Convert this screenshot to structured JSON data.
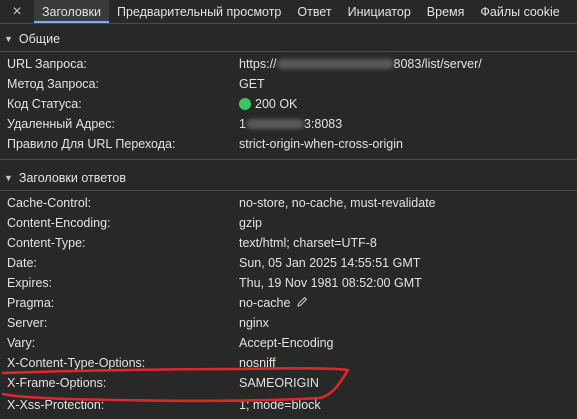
{
  "tabs": [
    {
      "label": "Заголовки",
      "active": true
    },
    {
      "label": "Предварительный просмотр",
      "active": false
    },
    {
      "label": "Ответ",
      "active": false
    },
    {
      "label": "Инициатор",
      "active": false
    },
    {
      "label": "Время",
      "active": false
    },
    {
      "label": "Файлы cookie",
      "active": false
    }
  ],
  "close_icon": "×",
  "general": {
    "title": "Общие",
    "rows": [
      {
        "key": "URL Запроса:",
        "value_prefix": "https://",
        "value_suffix": "8083/list/server/"
      },
      {
        "key": "Метод Запроса:",
        "value": "GET"
      },
      {
        "key": "Код Статуса:",
        "value": "200 OK",
        "status_color": "#3ec463"
      },
      {
        "key": "Удаленный Адрес:",
        "value_prefix": "1",
        "value_suffix": "3:8083"
      },
      {
        "key": "Правило Для URL Перехода:",
        "value": "strict-origin-when-cross-origin"
      }
    ]
  },
  "response_headers": {
    "title": "Заголовки ответов",
    "rows": [
      {
        "key": "Cache-Control:",
        "value": "no-store, no-cache, must-revalidate"
      },
      {
        "key": "Content-Encoding:",
        "value": "gzip"
      },
      {
        "key": "Content-Type:",
        "value": "text/html; charset=UTF-8"
      },
      {
        "key": "Date:",
        "value": "Sun, 05 Jan 2025 14:55:51 GMT"
      },
      {
        "key": "Expires:",
        "value": "Thu, 19 Nov 1981 08:52:00 GMT"
      },
      {
        "key": "Pragma:",
        "value": "no-cache"
      },
      {
        "key": "Server:",
        "value": "nginx"
      },
      {
        "key": "Vary:",
        "value": "Accept-Encoding"
      },
      {
        "key": "X-Content-Type-Options:",
        "value": "nosniff"
      },
      {
        "key": "X-Frame-Options:",
        "value": "SAMEORIGIN"
      },
      {
        "key": "X-Xss-Protection:",
        "value": "1; mode=block"
      }
    ]
  },
  "annotation_color": "#e0252b",
  "icons": {
    "collapse": "triangle-down-icon",
    "edit": "pencil-icon",
    "close": "close-icon"
  }
}
